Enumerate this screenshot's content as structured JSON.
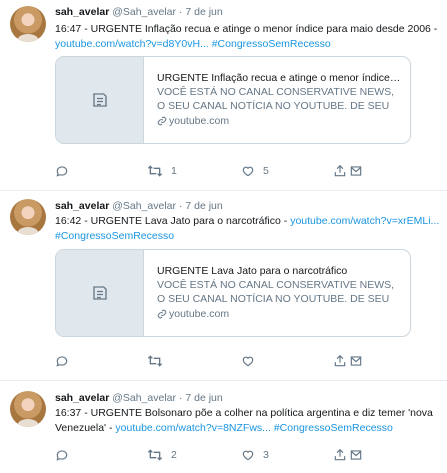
{
  "tweets": [
    {
      "name": "sah_avelar",
      "handle": "@Sah_avelar",
      "separator": "·",
      "date": "7 de jun",
      "text": "16:47 - URGENTE Inflação recua e atinge o menor índice para maio desde 2006 - ",
      "link": "youtube.com/watch?v=d8Y0vH...",
      "hashtag": "#CongressoSemRecesso",
      "card": {
        "title": "URGENTE Inflação recua e atinge o menor índice par...",
        "description": "VOCÊ ESTÁ NO CANAL CONSERVATIVE NEWS, O SEU CANAL NOTÍCIA NO YOUTUBE. DE SEU LIKE | ...",
        "domain": "youtube.com"
      },
      "retweets": "1",
      "likes": "5"
    },
    {
      "name": "sah_avelar",
      "handle": "@Sah_avelar",
      "separator": "·",
      "date": "7 de jun",
      "text": "16:42 - URGENTE Lava Jato para o narcotráfico - ",
      "link": "youtube.com/watch?v=xrEMLi...",
      "hashtag": "#CongressoSemRecesso",
      "card": {
        "title": "URGENTE Lava Jato para o narcotráfico",
        "description": "VOCÊ ESTÁ NO CANAL CONSERVATIVE NEWS, O SEU CANAL NOTÍCIA NO YOUTUBE. DE SEU LIKE | ...",
        "domain": "youtube.com"
      },
      "retweets": "",
      "likes": ""
    },
    {
      "name": "sah_avelar",
      "handle": "@Sah_avelar",
      "separator": "·",
      "date": "7 de jun",
      "text": "16:37 - URGENTE Bolsonaro põe a colher na política argentina e diz temer 'nova Venezuela' - ",
      "link": "youtube.com/watch?v=8NZFws...",
      "hashtag": "#CongressoSemRecesso",
      "retweets": "2",
      "likes": "3"
    }
  ],
  "colors": {
    "link": "#1b95e0",
    "muted": "#657786",
    "border": "#e6ecf0"
  },
  "icons": [
    "reply-icon",
    "retweet-icon",
    "like-icon",
    "share-icon",
    "dm-icon",
    "document-icon",
    "link-icon"
  ]
}
